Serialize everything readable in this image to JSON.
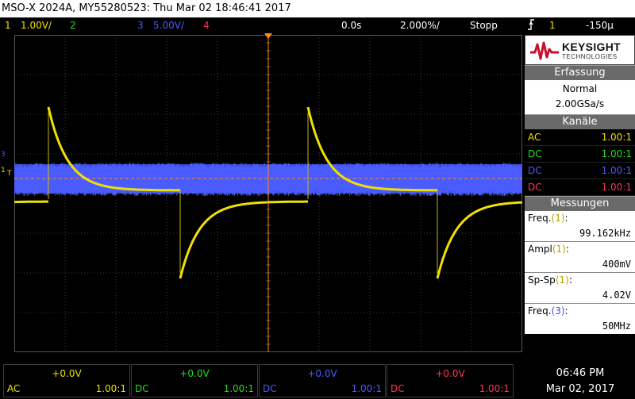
{
  "title_bar": {
    "text": "MSO-X 2024A, MY55280523: Thu Mar 02 18:46:41 2017"
  },
  "status_bar": {
    "ch1_num": "1",
    "ch1_scale": "1.00V/",
    "ch2_num": "2",
    "ch3_num": "3",
    "ch3_scale": "5.00V/",
    "ch4_num": "4",
    "time_offset": "0.0s",
    "time_scale": "2.000%/",
    "run_state": "Stopp",
    "trigger_icon": "trigger-edge-icon",
    "trigger_channel": "1",
    "trigger_level": "-150μ"
  },
  "colors": {
    "ch1": "#f0e000",
    "ch2": "#22dd22",
    "ch3": "#4a5cff",
    "ch4": "#ff3355",
    "trigger_line": "#ff8c1a"
  },
  "brand": {
    "name": "KEYSIGHT",
    "sub": "TECHNOLOGIES"
  },
  "acquisition": {
    "header": "Erfassung",
    "mode": "Normal",
    "rate": "2.00GSa/s"
  },
  "channels_panel": {
    "header": "Kanäle",
    "rows": [
      {
        "coupling": "AC",
        "ratio": "1.00:1"
      },
      {
        "coupling": "DC",
        "ratio": "1.00:1"
      },
      {
        "coupling": "DC",
        "ratio": "1.00:1"
      },
      {
        "coupling": "DC",
        "ratio": "1.00:1"
      }
    ]
  },
  "measurements": {
    "header": "Messungen",
    "items": [
      {
        "name": "Freq.",
        "src": "(1)",
        "suffix": ":",
        "value": "99.162kHz"
      },
      {
        "name": "Ampl",
        "src": "(1)",
        "suffix": ":",
        "value": "400mV"
      },
      {
        "name": "Sp-Sp",
        "src": "(1)",
        "suffix": ":",
        "value": "4.02V"
      },
      {
        "name": "Freq.",
        "src": "(3)",
        "suffix": ":",
        "value": "50MHz"
      }
    ]
  },
  "bottom_channels": [
    {
      "offset": "+0.0V",
      "coupling": "AC",
      "ratio": "1.00:1"
    },
    {
      "offset": "+0.0V",
      "coupling": "DC",
      "ratio": "1.00:1"
    },
    {
      "offset": "+0.0V",
      "coupling": "DC",
      "ratio": "1.00:1"
    },
    {
      "offset": "+0.0V",
      "coupling": "DC",
      "ratio": "1.00:1"
    }
  ],
  "clock": {
    "time": "06:46 PM",
    "date": "Mar 02, 2017"
  },
  "markers": {
    "ch1_ground": "1",
    "ch3_ground": "3",
    "trigger_level_marker": "T"
  }
}
